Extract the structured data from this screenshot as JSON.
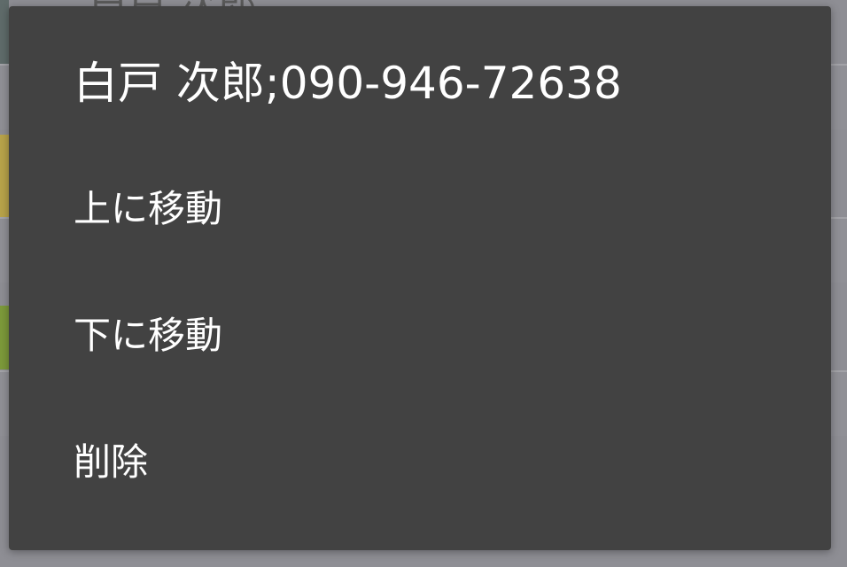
{
  "background": {
    "peek_title": "白戸 次郎"
  },
  "dialog": {
    "title": "白戸 次郎;090-946-72638",
    "items": [
      {
        "label": "上に移動"
      },
      {
        "label": "下に移動"
      },
      {
        "label": "削除"
      }
    ]
  },
  "colors": {
    "dialog_bg": "#424242",
    "text": "#ffffff",
    "scrim": "#8e8e94"
  }
}
